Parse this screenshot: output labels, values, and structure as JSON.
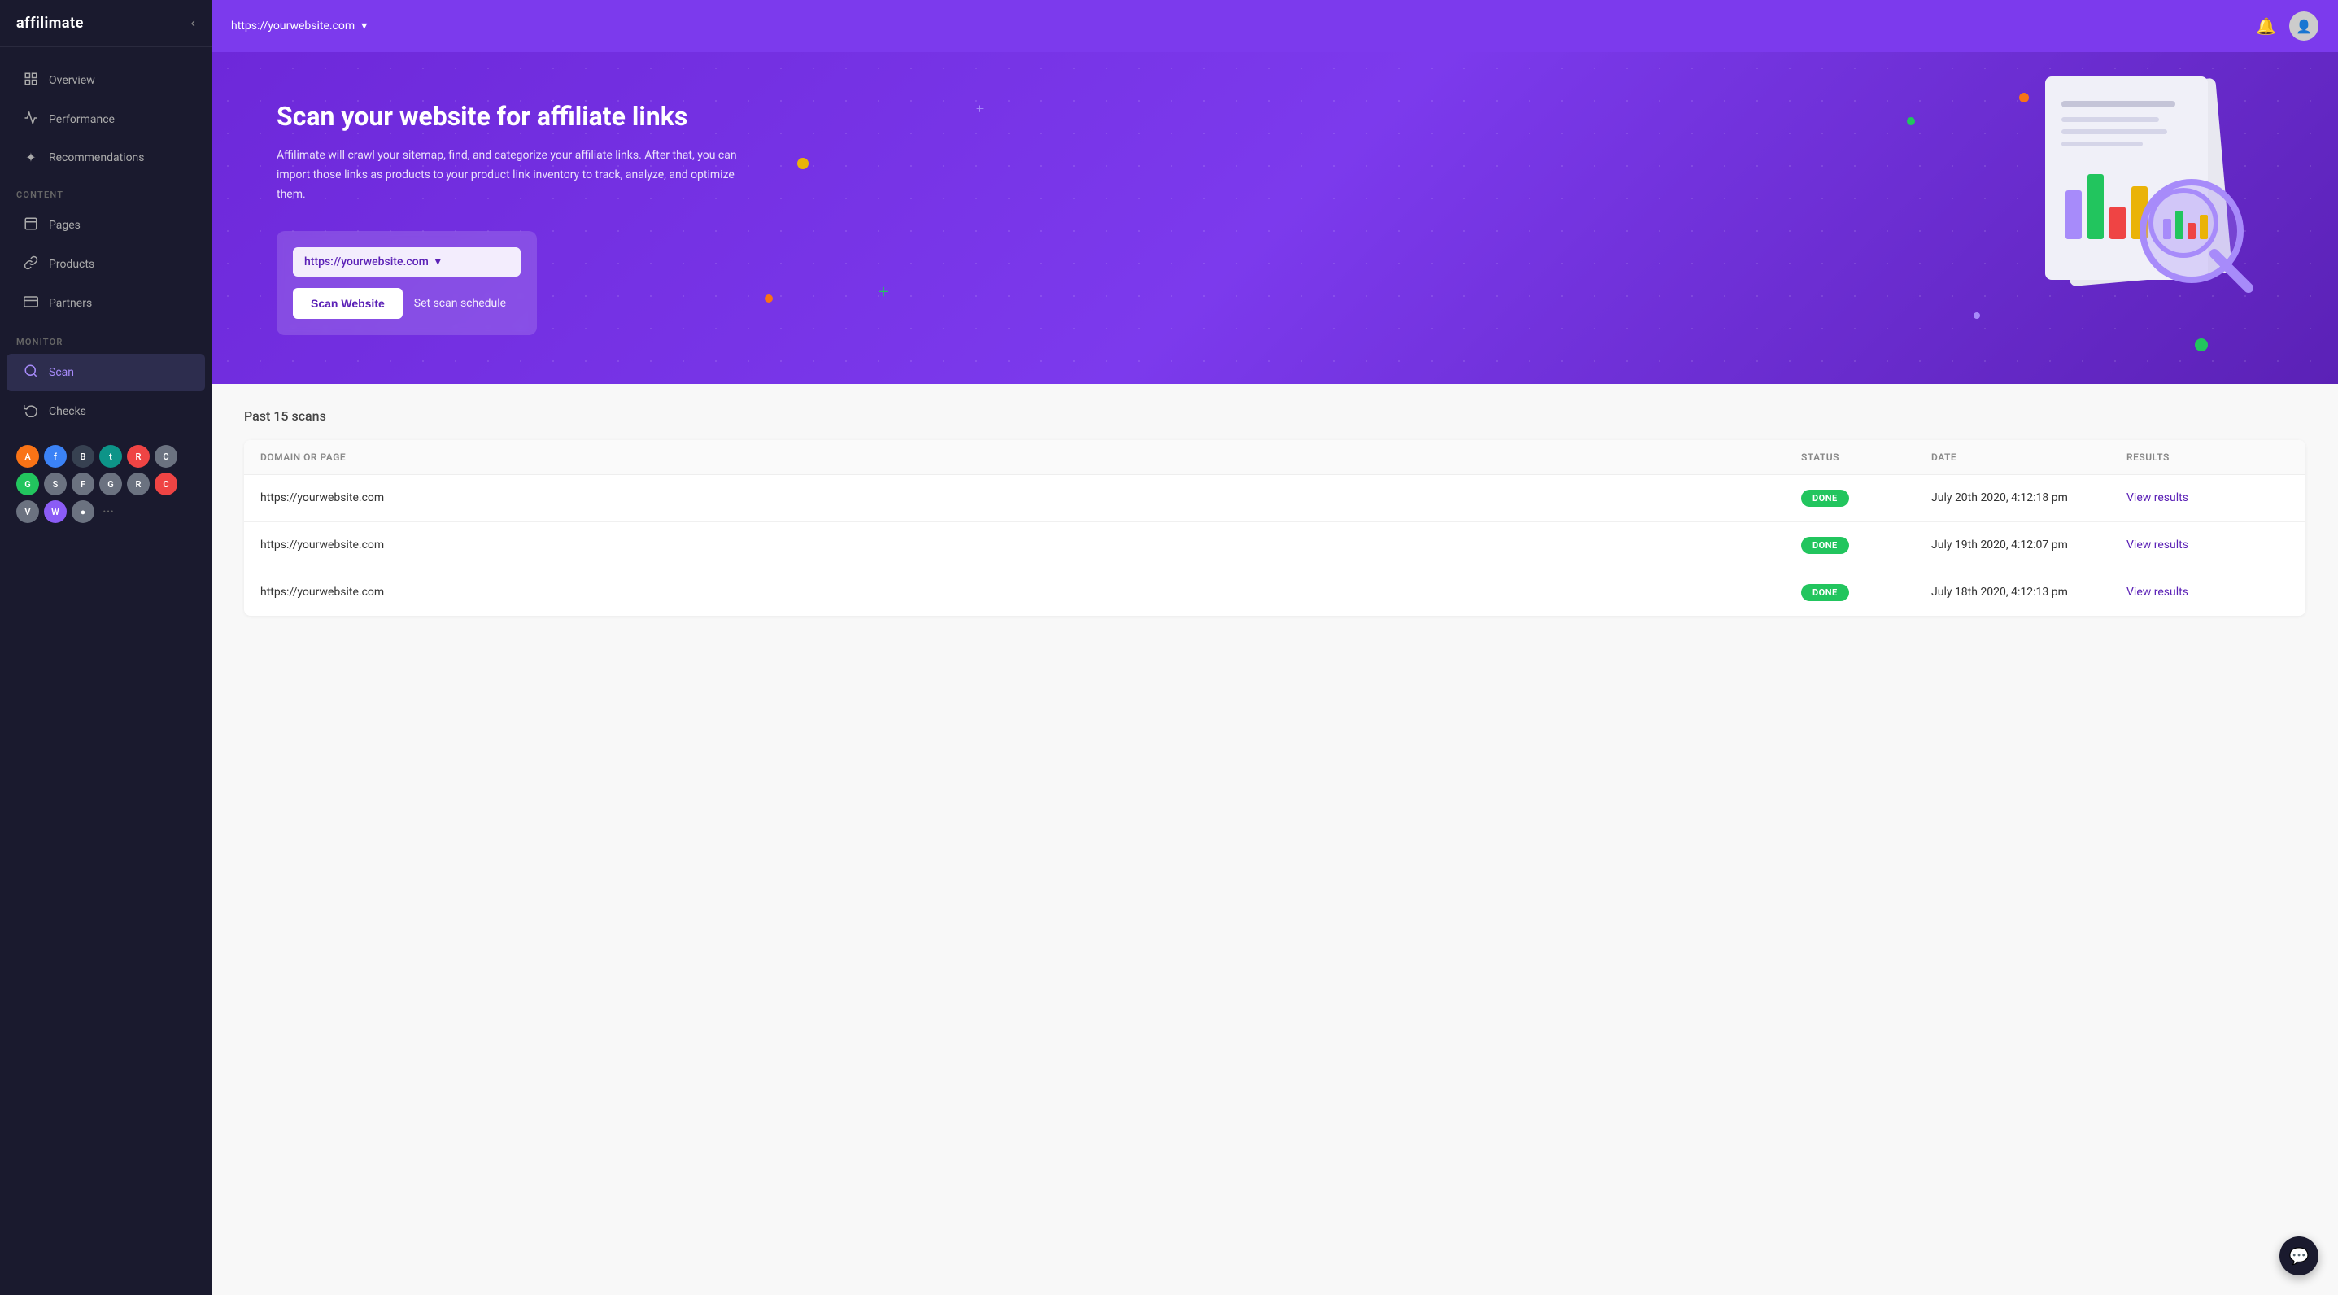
{
  "sidebar": {
    "logo": "affilimate",
    "collapse_label": "collapse",
    "nav_items": [
      {
        "id": "overview",
        "label": "Overview",
        "icon": "📊",
        "active": false
      },
      {
        "id": "performance",
        "label": "Performance",
        "icon": "⚡",
        "active": false
      },
      {
        "id": "recommendations",
        "label": "Recommendations",
        "icon": "✦",
        "active": false
      }
    ],
    "content_section_label": "CONTENT",
    "content_items": [
      {
        "id": "pages",
        "label": "Pages",
        "icon": "📄",
        "active": false
      },
      {
        "id": "products",
        "label": "Products",
        "icon": "🔗",
        "active": false
      },
      {
        "id": "partners",
        "label": "Partners",
        "icon": "🏷️",
        "active": false
      }
    ],
    "monitor_section_label": "MONITOR",
    "monitor_items": [
      {
        "id": "scan",
        "label": "Scan",
        "icon": "🔍",
        "active": true
      },
      {
        "id": "checks",
        "label": "Checks",
        "icon": "🔄",
        "active": false
      }
    ],
    "network_icons": [
      {
        "label": "A",
        "color": "orange"
      },
      {
        "label": "f",
        "color": "blue"
      },
      {
        "label": "B",
        "color": "dark"
      },
      {
        "label": "t",
        "color": "teal"
      },
      {
        "label": "R",
        "color": "red"
      },
      {
        "label": "C",
        "color": "gray"
      },
      {
        "label": "G",
        "color": "green"
      },
      {
        "label": "S",
        "color": "gray"
      },
      {
        "label": "F",
        "color": "gray"
      },
      {
        "label": "G",
        "color": "gray"
      },
      {
        "label": "R",
        "color": "gray"
      },
      {
        "label": "C",
        "color": "red"
      },
      {
        "label": "V",
        "color": "gray"
      },
      {
        "label": "W",
        "color": "purple"
      },
      {
        "label": "●",
        "color": "gray"
      }
    ]
  },
  "topbar": {
    "url": "https://yourwebsite.com",
    "dropdown_label": "▾"
  },
  "hero": {
    "title": "Scan your website for affiliate links",
    "description": "Affilimate will crawl your sitemap, find, and categorize your affiliate links. After that, you can import those links as products to your product link inventory to track, analyze, and optimize them.",
    "url_value": "https://yourwebsite.com",
    "scan_button_label": "Scan Website",
    "schedule_link_label": "Set scan schedule"
  },
  "scans_table": {
    "section_title": "Past 15 scans",
    "columns": [
      "Domain or Page",
      "Status",
      "Date",
      "Results"
    ],
    "rows": [
      {
        "domain": "https://yourwebsite.com",
        "status": "DONE",
        "date": "July 20th 2020, 4:12:18 pm",
        "results": "View results"
      },
      {
        "domain": "https://yourwebsite.com",
        "status": "DONE",
        "date": "July 19th 2020, 4:12:07 pm",
        "results": "View results"
      },
      {
        "domain": "https://yourwebsite.com",
        "status": "DONE",
        "date": "July 18th 2020, 4:12:13 pm",
        "results": "View results"
      }
    ]
  },
  "chat_widget": {
    "icon": "💬"
  }
}
